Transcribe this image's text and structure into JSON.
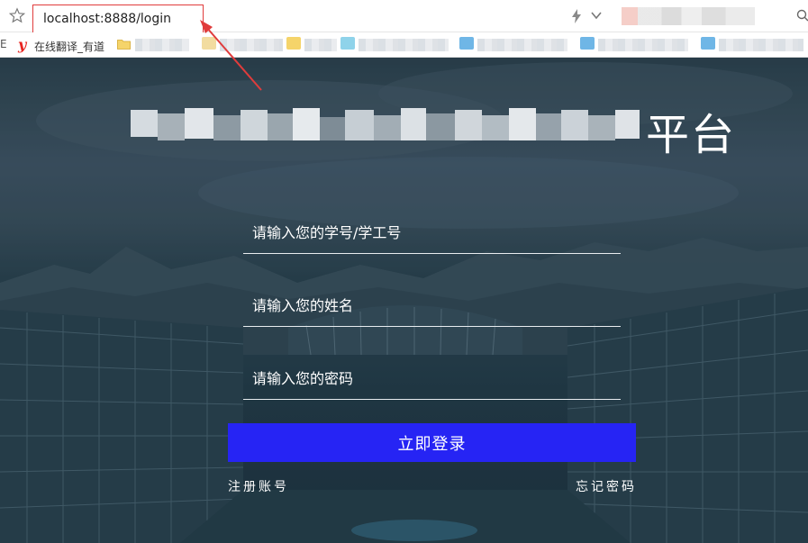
{
  "browser": {
    "url": "localhost:8888/login",
    "bookmarks": {
      "youdao_label": "在线翻译_有道",
      "edge_char": "E"
    }
  },
  "page": {
    "title_visible_suffix": "平台",
    "username_placeholder": "请输入您的学号/学工号",
    "name_placeholder": "请输入您的姓名",
    "password_placeholder": "请输入您的密码",
    "login_label": "立即登录",
    "register_label": "注册账号",
    "forgot_label": "忘记密码"
  },
  "colors": {
    "login_button": "#2624f4",
    "annotation_red": "#e03c3c"
  },
  "icons": [
    "star-icon",
    "bolt-icon",
    "chevron-down-icon",
    "search-icon",
    "youdao-icon",
    "folder-icon"
  ]
}
